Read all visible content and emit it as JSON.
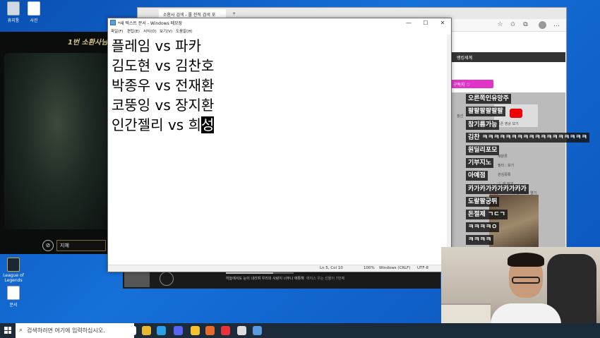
{
  "desktop": {
    "icons": [
      {
        "label": "휴지통",
        "icon": "recycle-bin-icon"
      },
      {
        "label": "사진",
        "icon": "image-file-icon"
      },
      {
        "label": "League of Legends",
        "icon": "app-shortcut-icon"
      },
      {
        "label": "문서",
        "icon": "document-icon"
      }
    ]
  },
  "game": {
    "title": "1번 소환사님의",
    "input_value": "지혜"
  },
  "browser": {
    "tabs": [
      {
        "label": "소환사 검색 - 롤 전적 검색 포"
      },
      {
        "label": "+"
      }
    ],
    "side_header": "랭킹세계",
    "badge": "구독자 ♡",
    "yt_caption": "오픈 영상 보기",
    "book_label": "서울",
    "mini": [
      "정선",
      "세분류",
      "필터 : 보기",
      "관심목록",
      "ⓘ 관 검색",
      "새 검색에서 열기"
    ]
  },
  "player": {
    "title": "하늘에서도 눈이 내리며 우리의 사랑이 너무나 애틋해",
    "subtitle": "에지스 우는 선물이 7번째"
  },
  "notepad": {
    "title": "*새 텍스트 문서 - Windows 메모장",
    "menu": [
      "파일(F)",
      "편집(E)",
      "서식(O)",
      "보기(V)",
      "도움말(H)"
    ],
    "lines": [
      "플레임 vs 파카",
      "김도현 vs 김찬호",
      "박종우 vs 전재환",
      "코뚱잉 vs 장지환"
    ],
    "last_line": {
      "text": "인간젤리 vs 희",
      "selected": "성"
    },
    "status": {
      "position": "Ln 5, Col 10",
      "zoom": "100%",
      "line_ending": "Windows (CRLF)",
      "encoding": "UTF-8"
    }
  },
  "chat": {
    "messages": [
      "오른쪽인유망주",
      "팔팔팔팔팔팔",
      "참기름가능",
      "김찬 ㅋㅋㅋㅋㅋㅋㅋㅋㅋㅋㅋㅋㅋㅋㅋㅋㅋㅋ",
      "원딜리포모",
      "기부지노",
      "아예점",
      "카가카가카가카가카가",
      "도랄팔궁뛰",
      "돈절제 ㄱㄷㄱ",
      "ㅋㅋㅋㅋㅇ",
      "ㅋㅋㅋㅋ"
    ]
  },
  "taskbar": {
    "search_placeholder": "검색하려면 여기에 입력하십시오.",
    "apps": [
      {
        "icon": "task-view-icon",
        "color": "#ffffff"
      },
      {
        "icon": "chrome-icon",
        "color": "#e8b830"
      },
      {
        "icon": "edge-icon",
        "color": "#2f9ee8"
      },
      {
        "icon": "discord-icon",
        "color": "#5865f2"
      },
      {
        "icon": "files-icon",
        "color": "#f2c230"
      },
      {
        "icon": "app-orange-icon",
        "color": "#e66a2c"
      },
      {
        "icon": "app-red-icon",
        "color": "#e8333d"
      },
      {
        "icon": "obs-icon",
        "color": "#dddddd"
      },
      {
        "icon": "app-blue-icon",
        "color": "#5a9ae0"
      }
    ]
  }
}
